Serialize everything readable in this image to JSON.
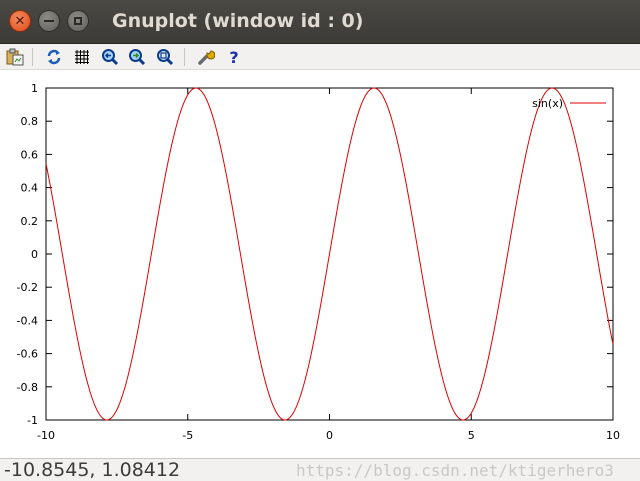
{
  "window": {
    "title": "Gnuplot (window id : 0)",
    "close_symbol": "✕"
  },
  "toolbar": {
    "icons": [
      "copy-to-clipboard-icon",
      "replot-icon",
      "grid-icon",
      "zoom-previous-icon",
      "zoom-next-icon",
      "autoscale-icon",
      "configure-icon",
      "help-icon"
    ]
  },
  "status": {
    "coordinates": "-10.8545, 1.08412",
    "watermark": "https://blog.csdn.net/ktigerhero3"
  },
  "colors": {
    "curve": "#e00000",
    "titlebar": "#3c3b37",
    "close_button": "#df4a16"
  },
  "chart_data": {
    "type": "line",
    "function": "sin(x)",
    "xlim": [
      -10,
      10
    ],
    "ylim": [
      -1,
      1
    ],
    "x_ticks": [
      -10,
      -5,
      0,
      5,
      10
    ],
    "x_tick_labels": [
      "-10",
      "-5",
      "0",
      "5",
      "10"
    ],
    "y_ticks": [
      -1,
      -0.8,
      -0.6,
      -0.4,
      -0.2,
      0,
      0.2,
      0.4,
      0.6,
      0.8,
      1
    ],
    "y_tick_labels": [
      "-1",
      "-0.8",
      "-0.6",
      "-0.4",
      "-0.2",
      "0",
      "0.2",
      "0.4",
      "0.6",
      "0.8",
      "1"
    ],
    "series": [
      {
        "name": "sin(x)",
        "color": "#e00000",
        "x": [
          -10,
          -9.5,
          -9,
          -8.5,
          -8,
          -7.5,
          -7,
          -6.5,
          -6,
          -5.5,
          -5,
          -4.5,
          -4,
          -3.5,
          -3,
          -2.5,
          -2,
          -1.5,
          -1,
          -0.5,
          0,
          0.5,
          1,
          1.5,
          2,
          2.5,
          3,
          3.5,
          4,
          4.5,
          5,
          5.5,
          6,
          6.5,
          7,
          7.5,
          8,
          8.5,
          9,
          9.5,
          10
        ],
        "y": [
          0.544,
          -0.075,
          -0.412,
          -0.798,
          -0.989,
          -0.938,
          -0.657,
          -0.215,
          0.279,
          0.706,
          0.959,
          0.978,
          0.757,
          0.351,
          -0.141,
          -0.598,
          -0.909,
          -0.997,
          -0.841,
          -0.479,
          0,
          0.479,
          0.841,
          0.997,
          0.909,
          0.598,
          0.141,
          -0.351,
          -0.757,
          -0.978,
          -0.959,
          -0.706,
          -0.279,
          0.215,
          0.657,
          0.938,
          0.989,
          0.798,
          0.412,
          -0.075,
          -0.544
        ]
      }
    ],
    "legend": {
      "label": "sin(x)",
      "position": "top-right"
    },
    "grid": false
  }
}
